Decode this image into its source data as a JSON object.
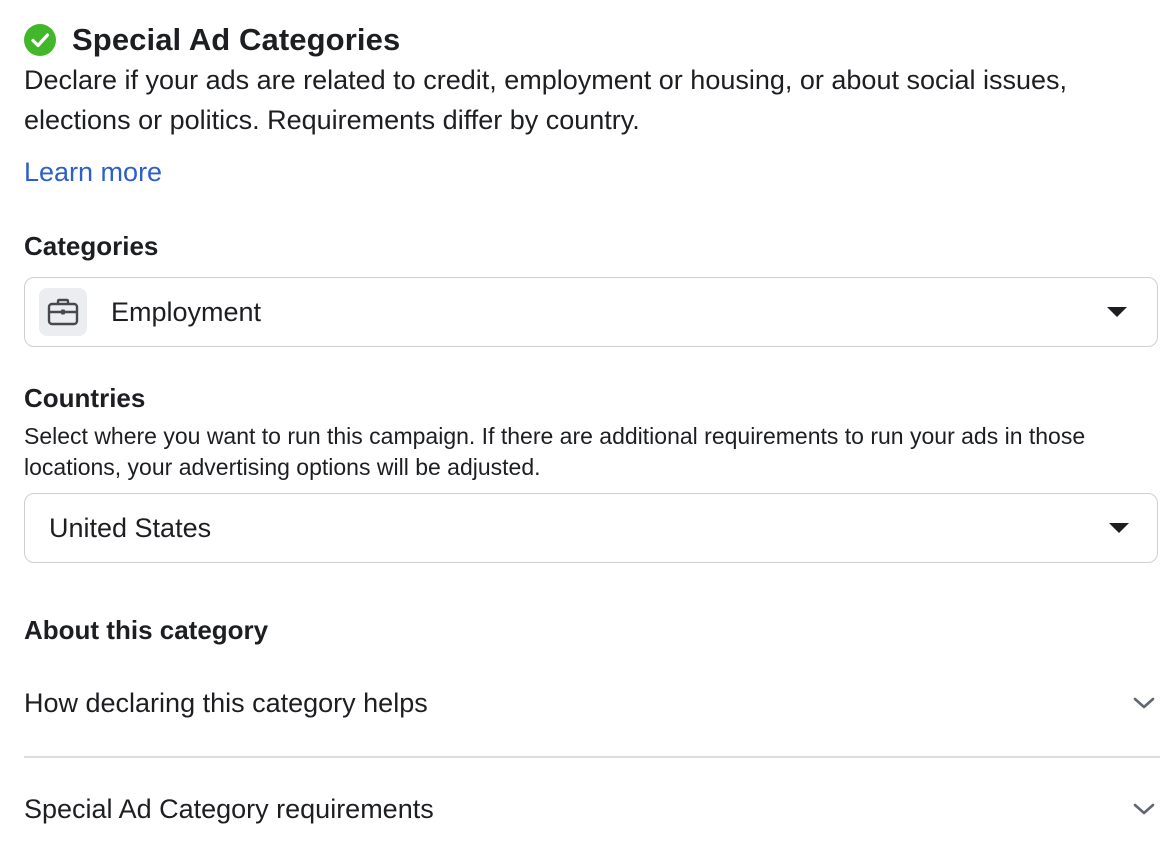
{
  "section": {
    "title": "Special Ad Categories",
    "description": "Declare if your ads are related to credit, employment or housing, or about social issues, elections or politics. Requirements differ by country.",
    "learn_more": "Learn more"
  },
  "categories": {
    "label": "Categories",
    "selected": "Employment",
    "icon": "briefcase-icon"
  },
  "countries": {
    "label": "Countries",
    "description": "Select where you want to run this campaign. If there are additional requirements to run your ads in those locations, your advertising options will be adjusted.",
    "selected": "United States"
  },
  "about": {
    "label": "About this category",
    "items": [
      {
        "label": "How declaring this category helps"
      },
      {
        "label": "Special Ad Category requirements"
      }
    ]
  },
  "colors": {
    "check_green": "#42b72a",
    "link_blue": "#2d5fcc",
    "border": "#ccd0d5"
  }
}
